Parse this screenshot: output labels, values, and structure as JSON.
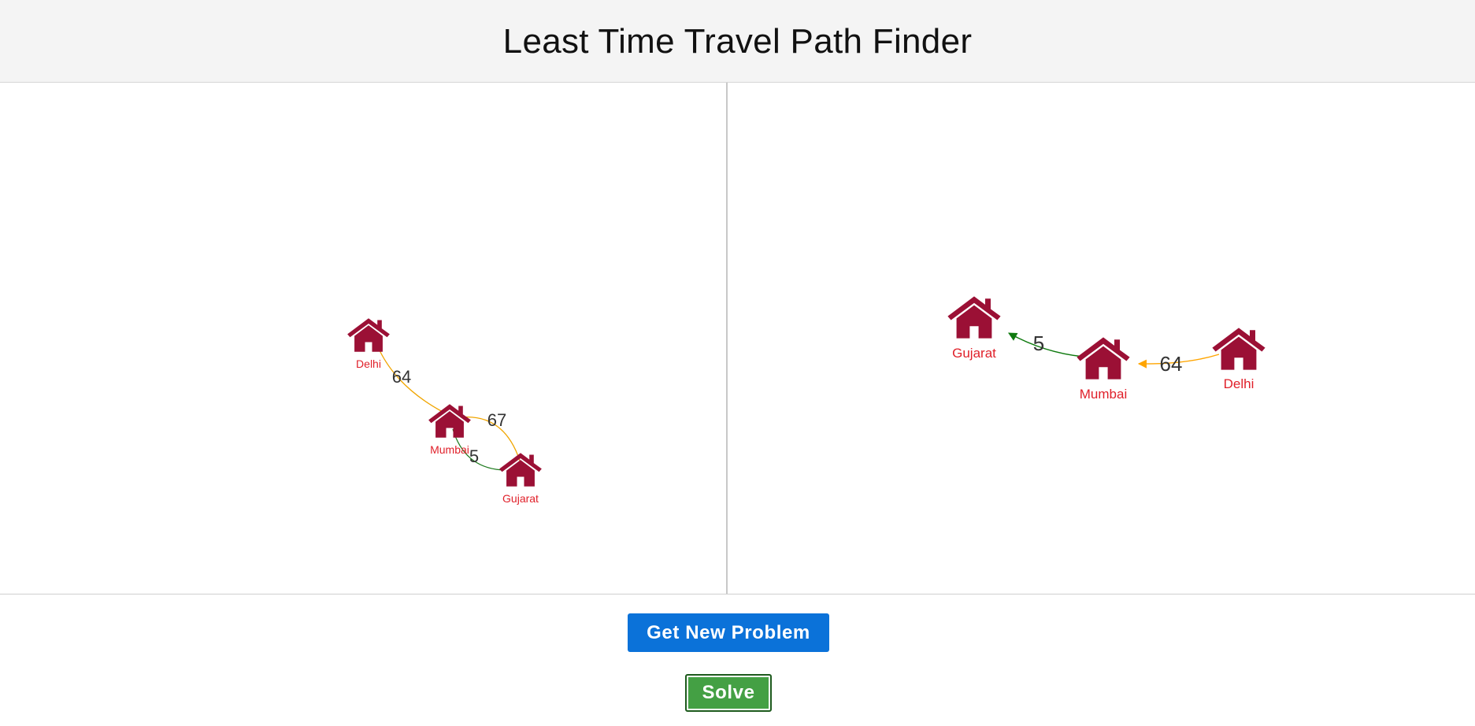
{
  "header": {
    "title": "Least Time Travel Path Finder"
  },
  "problem_graph": {
    "nodes": [
      "Delhi",
      "Mumbai",
      "Gujarat"
    ],
    "edges": [
      {
        "from": "Delhi",
        "to": "Mumbai",
        "weight": "64",
        "color": "#f0a500"
      },
      {
        "from": "Mumbai",
        "to": "Gujarat",
        "weight": "67",
        "color": "#f0a500"
      },
      {
        "from": "Mumbai",
        "to": "Gujarat",
        "weight": "5",
        "color": "#1e7a1e"
      }
    ]
  },
  "solution_graph": {
    "nodes": [
      "Gujarat",
      "Mumbai",
      "Delhi"
    ],
    "edges": [
      {
        "from": "Mumbai",
        "to": "Gujarat",
        "weight": "5",
        "color": "#0f7a0f",
        "directed": true
      },
      {
        "from": "Delhi",
        "to": "Mumbai",
        "weight": "64",
        "color": "#ffa500",
        "directed": true
      }
    ]
  },
  "colors": {
    "house": "#9b1035",
    "node_label": "#e0202a",
    "primary_button": "#0b72d9",
    "solve_button": "#44a044"
  },
  "controls": {
    "new_problem_label": "Get New Problem",
    "solve_label": "Solve"
  }
}
